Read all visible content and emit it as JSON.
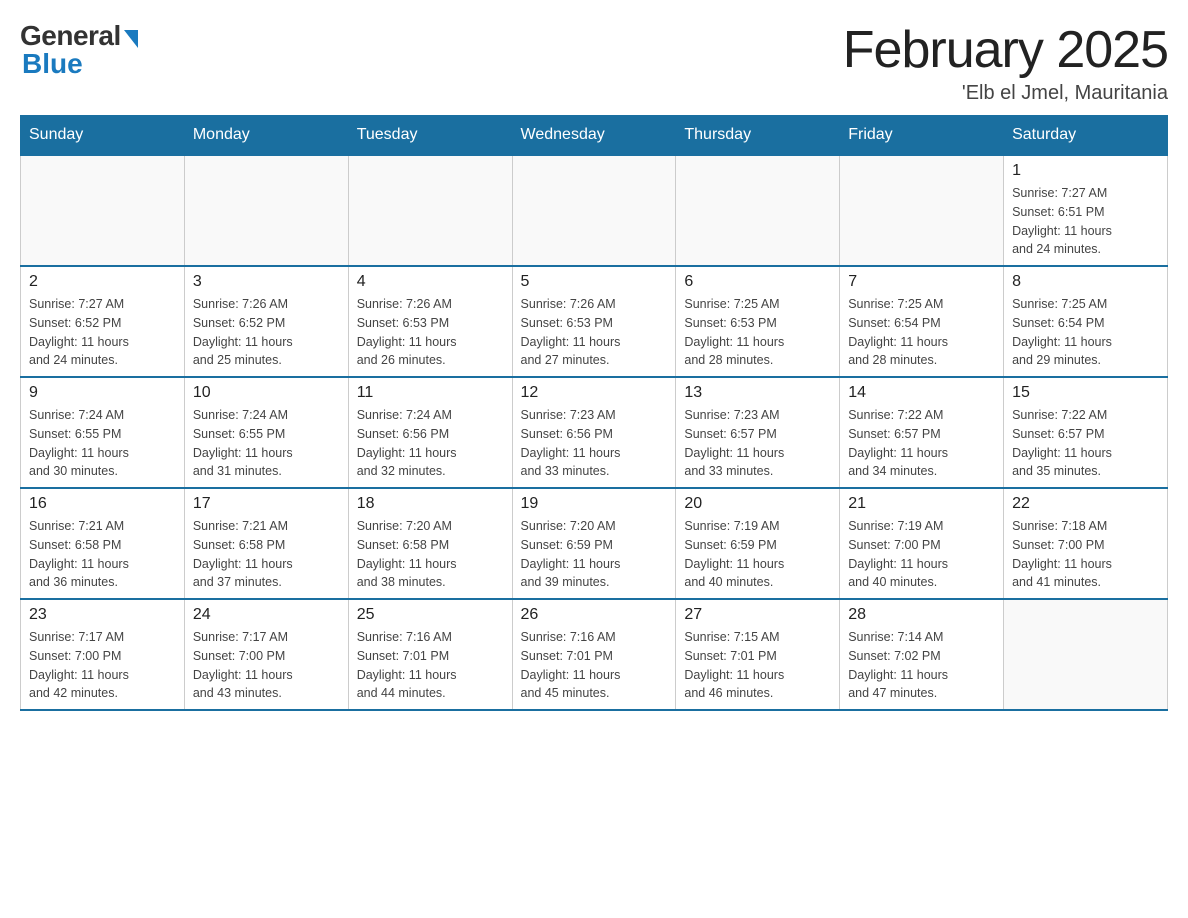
{
  "logo": {
    "general": "General",
    "blue": "Blue"
  },
  "title": "February 2025",
  "location": "'Elb el Jmel, Mauritania",
  "days_of_week": [
    "Sunday",
    "Monday",
    "Tuesday",
    "Wednesday",
    "Thursday",
    "Friday",
    "Saturday"
  ],
  "weeks": [
    [
      {
        "day": "",
        "info": ""
      },
      {
        "day": "",
        "info": ""
      },
      {
        "day": "",
        "info": ""
      },
      {
        "day": "",
        "info": ""
      },
      {
        "day": "",
        "info": ""
      },
      {
        "day": "",
        "info": ""
      },
      {
        "day": "1",
        "info": "Sunrise: 7:27 AM\nSunset: 6:51 PM\nDaylight: 11 hours\nand 24 minutes."
      }
    ],
    [
      {
        "day": "2",
        "info": "Sunrise: 7:27 AM\nSunset: 6:52 PM\nDaylight: 11 hours\nand 24 minutes."
      },
      {
        "day": "3",
        "info": "Sunrise: 7:26 AM\nSunset: 6:52 PM\nDaylight: 11 hours\nand 25 minutes."
      },
      {
        "day": "4",
        "info": "Sunrise: 7:26 AM\nSunset: 6:53 PM\nDaylight: 11 hours\nand 26 minutes."
      },
      {
        "day": "5",
        "info": "Sunrise: 7:26 AM\nSunset: 6:53 PM\nDaylight: 11 hours\nand 27 minutes."
      },
      {
        "day": "6",
        "info": "Sunrise: 7:25 AM\nSunset: 6:53 PM\nDaylight: 11 hours\nand 28 minutes."
      },
      {
        "day": "7",
        "info": "Sunrise: 7:25 AM\nSunset: 6:54 PM\nDaylight: 11 hours\nand 28 minutes."
      },
      {
        "day": "8",
        "info": "Sunrise: 7:25 AM\nSunset: 6:54 PM\nDaylight: 11 hours\nand 29 minutes."
      }
    ],
    [
      {
        "day": "9",
        "info": "Sunrise: 7:24 AM\nSunset: 6:55 PM\nDaylight: 11 hours\nand 30 minutes."
      },
      {
        "day": "10",
        "info": "Sunrise: 7:24 AM\nSunset: 6:55 PM\nDaylight: 11 hours\nand 31 minutes."
      },
      {
        "day": "11",
        "info": "Sunrise: 7:24 AM\nSunset: 6:56 PM\nDaylight: 11 hours\nand 32 minutes."
      },
      {
        "day": "12",
        "info": "Sunrise: 7:23 AM\nSunset: 6:56 PM\nDaylight: 11 hours\nand 33 minutes."
      },
      {
        "day": "13",
        "info": "Sunrise: 7:23 AM\nSunset: 6:57 PM\nDaylight: 11 hours\nand 33 minutes."
      },
      {
        "day": "14",
        "info": "Sunrise: 7:22 AM\nSunset: 6:57 PM\nDaylight: 11 hours\nand 34 minutes."
      },
      {
        "day": "15",
        "info": "Sunrise: 7:22 AM\nSunset: 6:57 PM\nDaylight: 11 hours\nand 35 minutes."
      }
    ],
    [
      {
        "day": "16",
        "info": "Sunrise: 7:21 AM\nSunset: 6:58 PM\nDaylight: 11 hours\nand 36 minutes."
      },
      {
        "day": "17",
        "info": "Sunrise: 7:21 AM\nSunset: 6:58 PM\nDaylight: 11 hours\nand 37 minutes."
      },
      {
        "day": "18",
        "info": "Sunrise: 7:20 AM\nSunset: 6:58 PM\nDaylight: 11 hours\nand 38 minutes."
      },
      {
        "day": "19",
        "info": "Sunrise: 7:20 AM\nSunset: 6:59 PM\nDaylight: 11 hours\nand 39 minutes."
      },
      {
        "day": "20",
        "info": "Sunrise: 7:19 AM\nSunset: 6:59 PM\nDaylight: 11 hours\nand 40 minutes."
      },
      {
        "day": "21",
        "info": "Sunrise: 7:19 AM\nSunset: 7:00 PM\nDaylight: 11 hours\nand 40 minutes."
      },
      {
        "day": "22",
        "info": "Sunrise: 7:18 AM\nSunset: 7:00 PM\nDaylight: 11 hours\nand 41 minutes."
      }
    ],
    [
      {
        "day": "23",
        "info": "Sunrise: 7:17 AM\nSunset: 7:00 PM\nDaylight: 11 hours\nand 42 minutes."
      },
      {
        "day": "24",
        "info": "Sunrise: 7:17 AM\nSunset: 7:00 PM\nDaylight: 11 hours\nand 43 minutes."
      },
      {
        "day": "25",
        "info": "Sunrise: 7:16 AM\nSunset: 7:01 PM\nDaylight: 11 hours\nand 44 minutes."
      },
      {
        "day": "26",
        "info": "Sunrise: 7:16 AM\nSunset: 7:01 PM\nDaylight: 11 hours\nand 45 minutes."
      },
      {
        "day": "27",
        "info": "Sunrise: 7:15 AM\nSunset: 7:01 PM\nDaylight: 11 hours\nand 46 minutes."
      },
      {
        "day": "28",
        "info": "Sunrise: 7:14 AM\nSunset: 7:02 PM\nDaylight: 11 hours\nand 47 minutes."
      },
      {
        "day": "",
        "info": ""
      }
    ]
  ]
}
